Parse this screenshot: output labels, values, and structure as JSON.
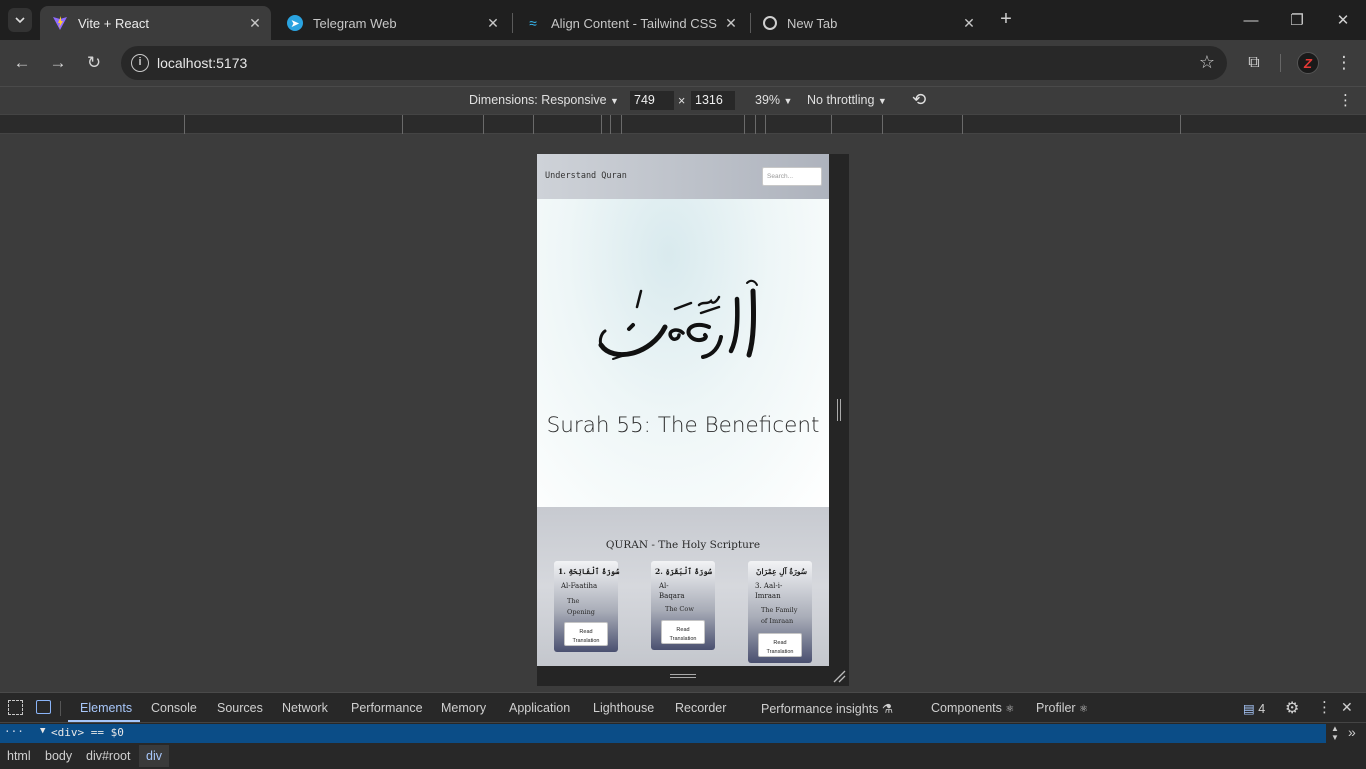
{
  "browser": {
    "tabs": [
      {
        "title": "Vite + React",
        "icon": "vite-icon",
        "active": true
      },
      {
        "title": "Telegram Web",
        "icon": "telegram-icon",
        "active": false
      },
      {
        "title": "Align Content - Tailwind CSS",
        "icon": "tailwind-icon",
        "active": false
      },
      {
        "title": "New Tab",
        "icon": "chrome-icon",
        "active": false
      }
    ],
    "url": "localhost:5173",
    "profile_initial": "Z"
  },
  "device_toolbar": {
    "dimensions_label": "Dimensions: Responsive",
    "width": "749",
    "times": "×",
    "height": "1316",
    "zoom": "39%",
    "throttling": "No throttling"
  },
  "site": {
    "brand": "Understand Quran",
    "search_placeholder": "Search...",
    "hero_title": "Surah 55: The Beneficent",
    "scripture_title": "QURAN - The Holy Scripture",
    "cards": [
      {
        "arabic": "سُورَةُ ٱلْفَاتِحَةِ",
        "number": "1.",
        "english_lines": [
          "Al-Faatiha"
        ],
        "translation_lines": [
          "The",
          "Opening"
        ],
        "button_lines": [
          "Read",
          "Translation"
        ]
      },
      {
        "arabic": "سُورَةُ ٱلْبَقَرَةِ",
        "number": "2.",
        "english_lines": [
          "Al-",
          "Baqara"
        ],
        "translation_lines": [
          "The Cow"
        ],
        "button_lines": [
          "Read",
          "Translation"
        ]
      },
      {
        "arabic": "سُورَةُ آلِ عِمْرَانَ",
        "number": "3.",
        "english_lines": [
          "Aal-i-",
          "Imraan"
        ],
        "translation_lines": [
          "The Family",
          "of Imraan"
        ],
        "button_lines": [
          "Read",
          "Translation"
        ]
      }
    ]
  },
  "devtools": {
    "tabs": [
      "Elements",
      "Console",
      "Sources",
      "Network",
      "Performance",
      "Memory",
      "Application",
      "Lighthouse",
      "Recorder",
      "Performance insights",
      "Components",
      "Profiler"
    ],
    "issues_count": "4",
    "selected_node": "<div> == $0",
    "breadcrumbs": [
      "html",
      "body",
      "div#root",
      "div"
    ]
  }
}
